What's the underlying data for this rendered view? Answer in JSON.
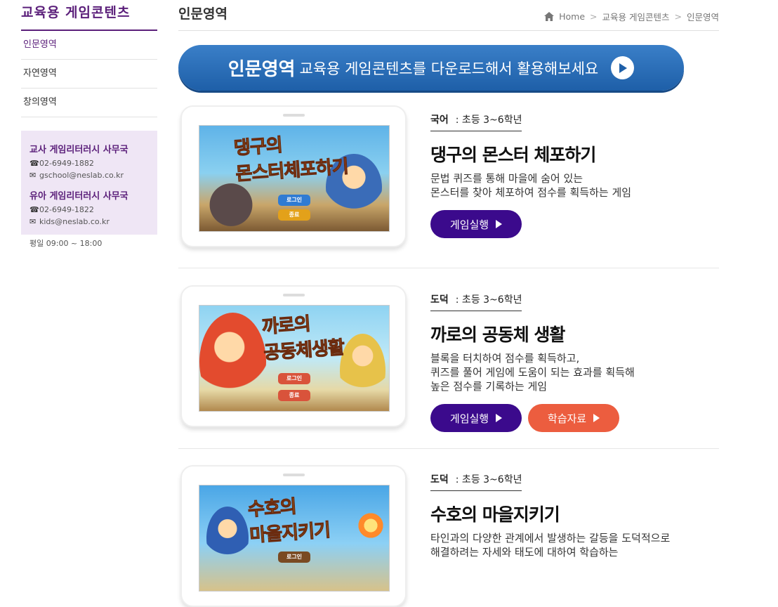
{
  "sidebar": {
    "title": "교육용 게임콘텐츠",
    "items": [
      {
        "label": "인문영역"
      },
      {
        "label": "자연영역"
      },
      {
        "label": "창의영역"
      }
    ],
    "offices": [
      {
        "name": "교사 게임리터러시 사무국",
        "phone": "02-6949-1882",
        "email": "gschool@neslab.co.kr"
      },
      {
        "name": "유아 게임리터러시 사무국",
        "phone": "02-6949-1822",
        "email": "kids@neslab.co.kr"
      }
    ],
    "hours": "평일 09:00 ~ 18:00"
  },
  "header": {
    "title": "인문영역",
    "breadcrumb": [
      "Home",
      "교육용 게임콘텐츠",
      "인문영역"
    ]
  },
  "banner": {
    "strong": "인문영역",
    "text": "교육용 게임콘텐츠를 다운로드해서 활용해보세요"
  },
  "games": [
    {
      "subject": "국어",
      "grade": ": 초등 3~6학년",
      "title": "댕구의 몬스터 체포하기",
      "screen_title_a": "댕구의",
      "screen_title_b": "몬스터",
      "screen_title_c": "체포하기",
      "screen_btn1": "로그인",
      "screen_btn2": "종료",
      "desc": "문법 퀴즈를 통해 마을에 숨어 있는\n몬스터를 찾아 체포하여 점수를 획득하는 게임",
      "run_label": "게임실행"
    },
    {
      "subject": "도덕",
      "grade": ": 초등 3~6학년",
      "title": "까로의 공동체 생활",
      "screen_title_a": "까로의",
      "screen_title_b": "공동체생활",
      "screen_btn1": "로그인",
      "screen_btn2": "종료",
      "desc": "블록을 터치하여 점수를 획득하고,\n퀴즈를 풀어 게임에 도움이 되는 효과를 획득해\n높은 점수를 기록하는 게임",
      "run_label": "게임실행",
      "study_label": "학습자료"
    },
    {
      "subject": "도덕",
      "grade": ": 초등 3~6학년",
      "title": "수호의 마을지키기",
      "screen_title_a": "수호의",
      "screen_title_b": "마을지키기",
      "screen_btn1": "로그인",
      "desc": "타인과의 다양한 관계에서 발생하는 갈등을 도덕적으로\n해결하려는 자세와 태도에 대하여 학습하는"
    }
  ]
}
